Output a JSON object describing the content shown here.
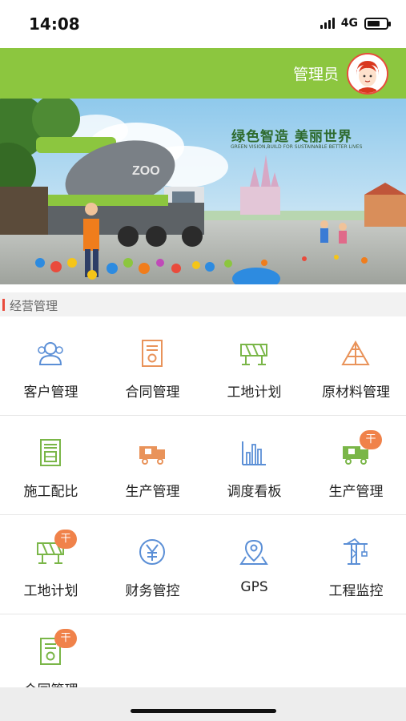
{
  "status_bar": {
    "time": "14:08",
    "network": "4G",
    "battery_level": 0.7
  },
  "header": {
    "user_name": "管理员",
    "avatar_icon": "user-avatar-icon",
    "bar_color": "#8cc63f"
  },
  "banner": {
    "title": "绿色智造  美丽世界",
    "subtitle": "GREEN VISION,BUILD FOR SUSTAINABLE BETTER LIVES",
    "truck_brand": "ZOO",
    "slide_count": 4,
    "active_slide": 2
  },
  "section": {
    "title": "经营管理",
    "accent_color": "#e94b3c"
  },
  "grid_items": [
    {
      "label": "客户管理",
      "icon": "customers-icon",
      "badge": ""
    },
    {
      "label": "合同管理",
      "icon": "contract-icon",
      "badge": ""
    },
    {
      "label": "工地计划",
      "icon": "site-plan-icon",
      "badge": ""
    },
    {
      "label": "原材料管理",
      "icon": "materials-icon",
      "badge": ""
    },
    {
      "label": "施工配比",
      "icon": "mix-ratio-icon",
      "badge": ""
    },
    {
      "label": "生产管理",
      "icon": "production-truck-icon",
      "badge": ""
    },
    {
      "label": "调度看板",
      "icon": "dispatch-chart-icon",
      "badge": ""
    },
    {
      "label": "生产管理",
      "icon": "production-truck-icon",
      "badge": "干"
    },
    {
      "label": "工地计划",
      "icon": "site-plan-icon",
      "badge": "干"
    },
    {
      "label": "财务管控",
      "icon": "finance-yen-icon",
      "badge": ""
    },
    {
      "label": "GPS",
      "icon": "gps-location-icon",
      "badge": ""
    },
    {
      "label": "工程监控",
      "icon": "crane-monitor-icon",
      "badge": ""
    },
    {
      "label": "合同管理",
      "icon": "contract-icon",
      "badge": "干"
    }
  ]
}
